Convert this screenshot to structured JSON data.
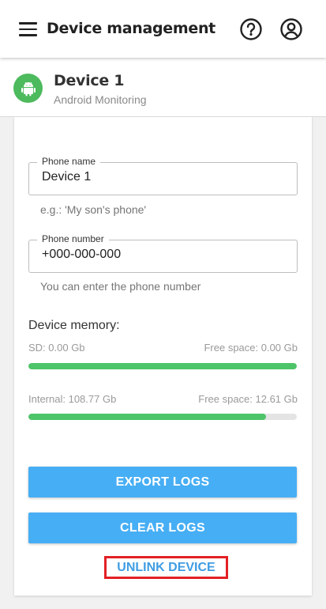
{
  "appbar": {
    "title": "Device management",
    "icons": [
      "menu-icon",
      "help-icon",
      "account-icon"
    ]
  },
  "device": {
    "name": "Device 1",
    "subtitle": "Android Monitoring",
    "icon": "android-icon",
    "accent": "#4cba5d"
  },
  "form": {
    "phone_name": {
      "label": "Phone name",
      "value": "Device 1",
      "helper": "e.g.: 'My son's phone'"
    },
    "phone_number": {
      "label": "Phone number",
      "value": "+000-000-000",
      "helper": "You can enter the phone number"
    }
  },
  "memory": {
    "title": "Device memory:",
    "sd": {
      "label": "SD: 0.00 Gb",
      "free": "Free space: 0.00 Gb",
      "used_fraction": 1.0
    },
    "internal": {
      "label": "Internal: 108.77 Gb",
      "free": "Free space: 12.61 Gb",
      "used_fraction": 0.884
    }
  },
  "actions": {
    "export": "EXPORT LOGS",
    "clear": "CLEAR LOGS",
    "unlink": "UNLINK DEVICE"
  },
  "colors": {
    "primary_button": "#46aef4",
    "progress": "#4ec468",
    "highlight_border": "#e32024",
    "link_text": "#3f9de3"
  }
}
